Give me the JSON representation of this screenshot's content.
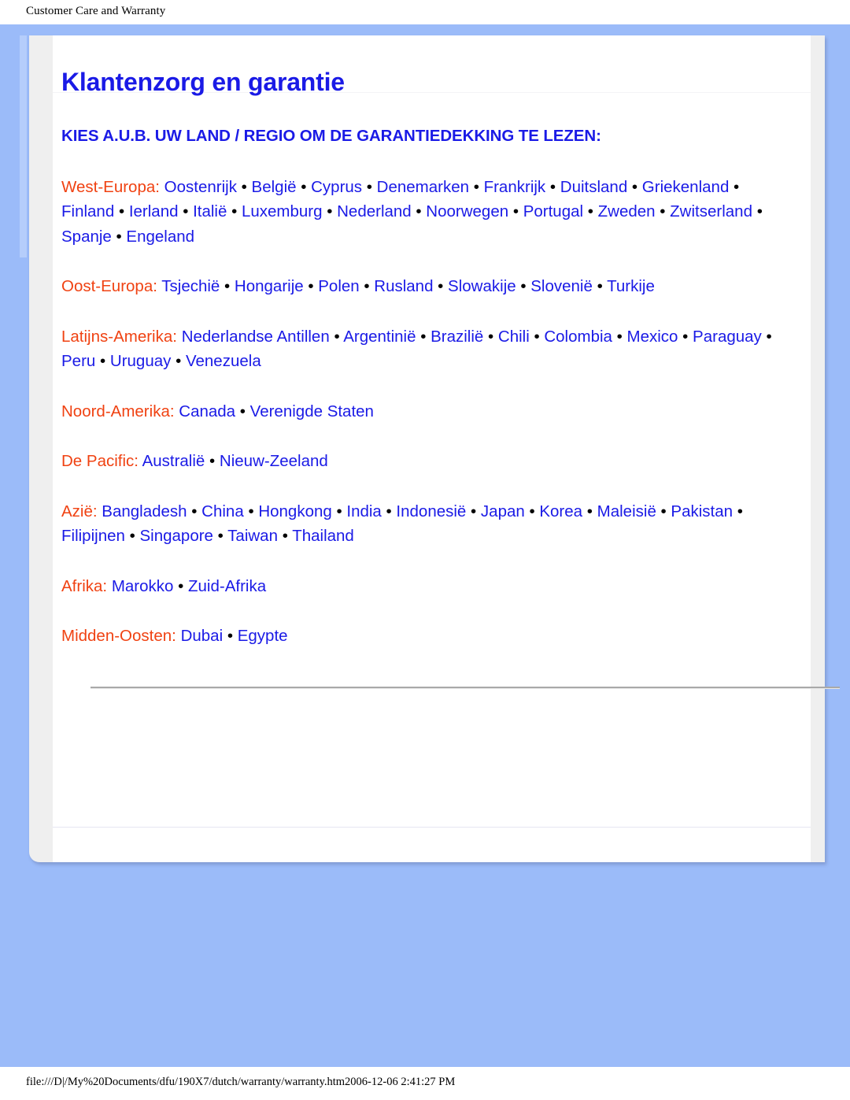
{
  "print_header": {
    "title": "Customer Care and Warranty"
  },
  "print_footer": {
    "url_and_timestamp": "file:///D|/My%20Documents/dfu/190X7/dutch/warranty/warranty.htm2006-12-06 2:41:27 PM"
  },
  "document": {
    "title": "Klantenzorg en garantie",
    "lead": "KIES A.U.B. UW LAND / REGIO OM DE GARANTIEDEKKING TE LEZEN:",
    "separator": " • ",
    "colon": ":",
    "regions": [
      {
        "label": "West-Europa",
        "countries": "Oostenrijk • België • Cyprus • Denemarken • Frankrijk • Duitsland • Griekenland • Finland • Ierland • Italië • Luxemburg • Nederland • Noorwegen • Portugal • Zweden • Zwitserland • Spanje • Engeland"
      },
      {
        "label": "Oost-Europa",
        "countries": "Tsjechië • Hongarije • Polen • Rusland • Slowakije • Slovenië • Turkije"
      },
      {
        "label": "Latijns-Amerika",
        "countries": "Nederlandse Antillen • Argentinië • Brazilië • Chili • Colombia • Mexico • Paraguay • Peru • Uruguay • Venezuela"
      },
      {
        "label": "Noord-Amerika",
        "countries": "Canada • Verenigde Staten"
      },
      {
        "label": "De Pacific",
        "countries": "Australië • Nieuw-Zeeland"
      },
      {
        "label": "Azië",
        "countries": "Bangladesh • China • Hongkong • India • Indonesië • Japan • Korea • Maleisië • Pakistan • Filipijnen • Singapore • Taiwan • Thailand"
      },
      {
        "label": "Afrika",
        "countries": "Marokko • Zuid-Afrika"
      },
      {
        "label": "Midden-Oosten",
        "countries": "Dubai • Egypte"
      }
    ]
  },
  "colors": {
    "page_background": "#9bbbf9",
    "link_blue": "#1a1ae6",
    "region_label_orange": "#f04212",
    "card_gutter_grey": "#efefef",
    "rule_grey": "#a9a9a9"
  }
}
